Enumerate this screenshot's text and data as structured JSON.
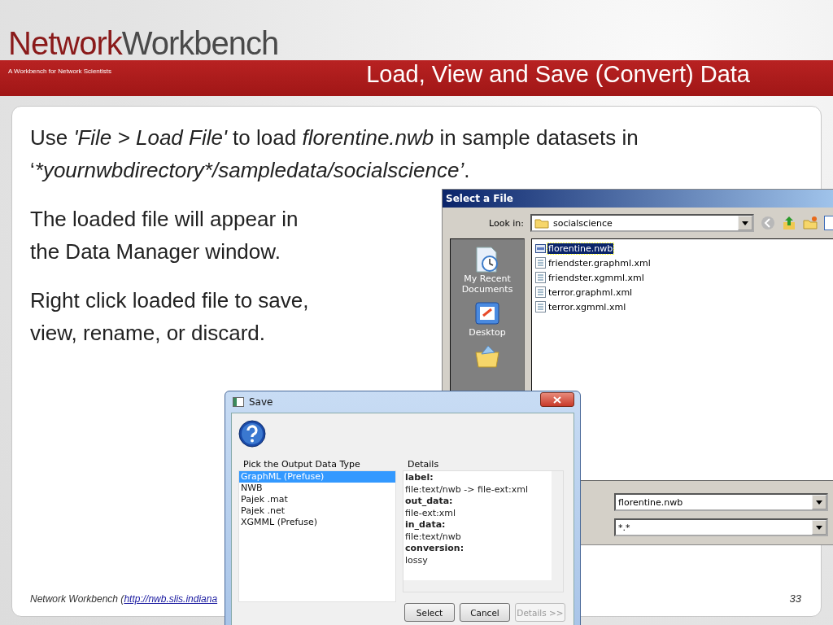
{
  "logo": {
    "part_1": "Network",
    "part_2": "Workbench",
    "tagline": "A Workbench for Network Scientists"
  },
  "title": "Load, View and Save (Convert) Data",
  "paragraphs": [
    [
      {
        "text": "Use ",
        "italic": false
      },
      {
        "text": "'File > Load File'",
        "italic": true
      },
      {
        "text": " to load ",
        "italic": false
      },
      {
        "text": "florentine.nwb",
        "italic": true
      },
      {
        "text": " in sample datasets in ‘",
        "italic": false
      },
      {
        "text": "*yournwbdirectory*/sampledata/socialscience’",
        "italic": true
      },
      {
        "text": ".",
        "italic": false
      }
    ],
    [
      {
        "text": "The loaded file will appear in the Data Manager window.",
        "italic": false
      }
    ],
    [
      {
        "text": "Right click loaded file to save, view, rename, or discard.",
        "italic": false
      }
    ]
  ],
  "select_dialog": {
    "title": "Select a File",
    "look_in_label": "Look in:",
    "look_in_value": "socialscience",
    "places": [
      {
        "label": "My Recent Documents",
        "kind": "recent"
      },
      {
        "label": "Desktop",
        "kind": "desktop"
      }
    ],
    "files": [
      {
        "name": "florentine.nwb",
        "kind": "nwb",
        "selected": true
      },
      {
        "name": "friendster.graphml.xml",
        "kind": "xml",
        "selected": false
      },
      {
        "name": "friendster.xgmml.xml",
        "kind": "xml",
        "selected": false
      },
      {
        "name": "terror.graphml.xml",
        "kind": "xml",
        "selected": false
      },
      {
        "name": "terror.xgmml.xml",
        "kind": "xml",
        "selected": false
      }
    ],
    "file_name_value": "florentine.nwb",
    "file_type_value": "*.*"
  },
  "save_dialog": {
    "title": "Save",
    "list_title": "Pick the Output Data Type",
    "types": [
      {
        "label": "GraphML (Prefuse)",
        "selected": true
      },
      {
        "label": "NWB",
        "selected": false
      },
      {
        "label": "Pajek .mat",
        "selected": false
      },
      {
        "label": "Pajek .net",
        "selected": false
      },
      {
        "label": "XGMML (Prefuse)",
        "selected": false
      }
    ],
    "details_title": "Details",
    "details": [
      {
        "text": "label:",
        "bold": true
      },
      {
        "text": "file:text/nwb -> file-ext:xml",
        "bold": false
      },
      {
        "text": "out_data:",
        "bold": true
      },
      {
        "text": "file-ext:xml",
        "bold": false
      },
      {
        "text": "in_data:",
        "bold": true
      },
      {
        "text": "file:text/nwb",
        "bold": false
      },
      {
        "text": "conversion:",
        "bold": true
      },
      {
        "text": "lossy",
        "bold": false
      }
    ],
    "buttons": [
      {
        "label": "Select",
        "disabled": false
      },
      {
        "label": "Cancel",
        "disabled": false
      },
      {
        "label": "Details >>",
        "disabled": true
      }
    ]
  },
  "footer": {
    "text": "Network Workbench (",
    "link": "http://nwb.slis.indiana",
    "page": "33"
  }
}
